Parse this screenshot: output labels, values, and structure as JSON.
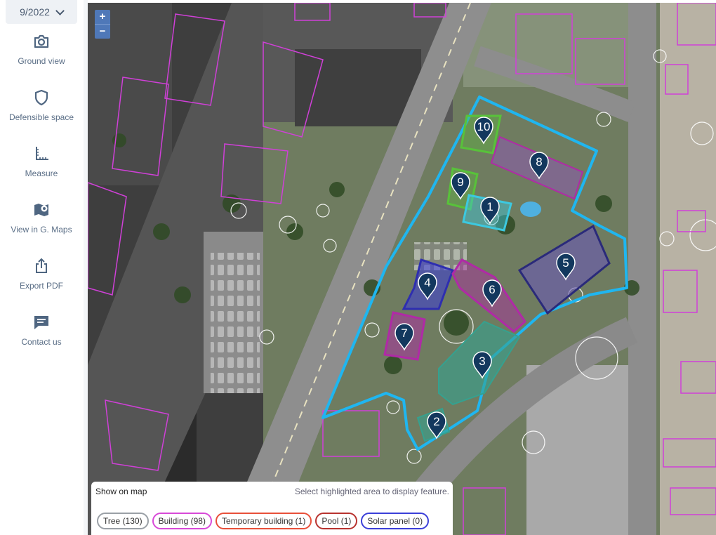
{
  "date_selector": {
    "value": "9/2022"
  },
  "sidebar": {
    "items": [
      {
        "label": "Ground view",
        "icon": "camera-icon"
      },
      {
        "label": "Defensible space",
        "icon": "shield-icon"
      },
      {
        "label": "Measure",
        "icon": "ruler-icon"
      },
      {
        "label": "View in G. Maps",
        "icon": "map-pin-icon"
      },
      {
        "label": "Export PDF",
        "icon": "export-icon"
      },
      {
        "label": "Contact us",
        "icon": "chat-icon"
      }
    ]
  },
  "map_controls": {
    "zoom_in": "+",
    "zoom_out": "−"
  },
  "markers": [
    "1",
    "2",
    "3",
    "4",
    "5",
    "6",
    "7",
    "8",
    "9",
    "10"
  ],
  "legend_panel": {
    "title": "Show on map",
    "hint": "Select highlighted area to display feature.",
    "chips": [
      {
        "label": "Tree (130)",
        "color": "#9aa0a6"
      },
      {
        "label": "Building (98)",
        "color": "#d84ad8"
      },
      {
        "label": "Temporary building (1)",
        "color": "#e8503a"
      },
      {
        "label": "Pool (1)",
        "color": "#b8332f"
      },
      {
        "label": "Solar panel (0)",
        "color": "#3b3fd8"
      }
    ]
  },
  "colors": {
    "parcel": "#1fb6f0",
    "marker": "#13385e",
    "building_outline": "#d040d8",
    "teal": "#35a18f",
    "purple": "#8d5ab0",
    "green": "#58c23a",
    "cyan": "#3cc9e0",
    "navy": "#2a2a7a",
    "magenta": "#b02aa6"
  }
}
